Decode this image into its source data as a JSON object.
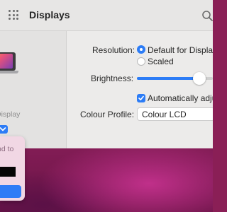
{
  "window": {
    "title": "Displays"
  },
  "left_pane": {
    "display_label": "Display",
    "popover_label": "nd to"
  },
  "settings": {
    "resolution_label": "Resolution:",
    "resolution_options": [
      {
        "label": "Default for Display",
        "selected": true
      },
      {
        "label": "Scaled",
        "selected": false
      }
    ],
    "brightness_label": "Brightness:",
    "brightness_level": 0.82,
    "auto_brightness": {
      "label": "Automatically adju",
      "checked": true
    },
    "colour_profile_label": "Colour Profile:",
    "colour_profile_value": "Colour LCD"
  },
  "colors": {
    "accent": "#2c7cf6"
  }
}
